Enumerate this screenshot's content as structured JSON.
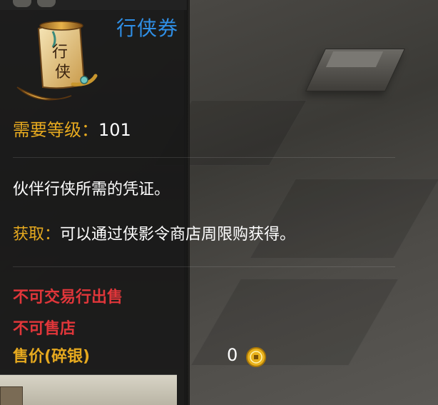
{
  "item": {
    "name": "行侠券",
    "icon": "scroll-icon",
    "icon_glyphs": [
      "行",
      "侠"
    ],
    "level_label": "需要等级：",
    "level_value": "101",
    "description": "伙伴行侠所需的凭证。",
    "source_label": "获取：",
    "source_text": "可以通过侠影令商店周限购获得。",
    "restrictions": [
      "不可交易行出售",
      "不可售店"
    ],
    "price_label": "售价(碎银)",
    "price_value": "0",
    "price_icon": "coin-icon"
  },
  "colors": {
    "title": "#2f8fe6",
    "label_gold": "#e6a91f",
    "restriction_red": "#e0363a",
    "text_white": "#ffffff"
  }
}
